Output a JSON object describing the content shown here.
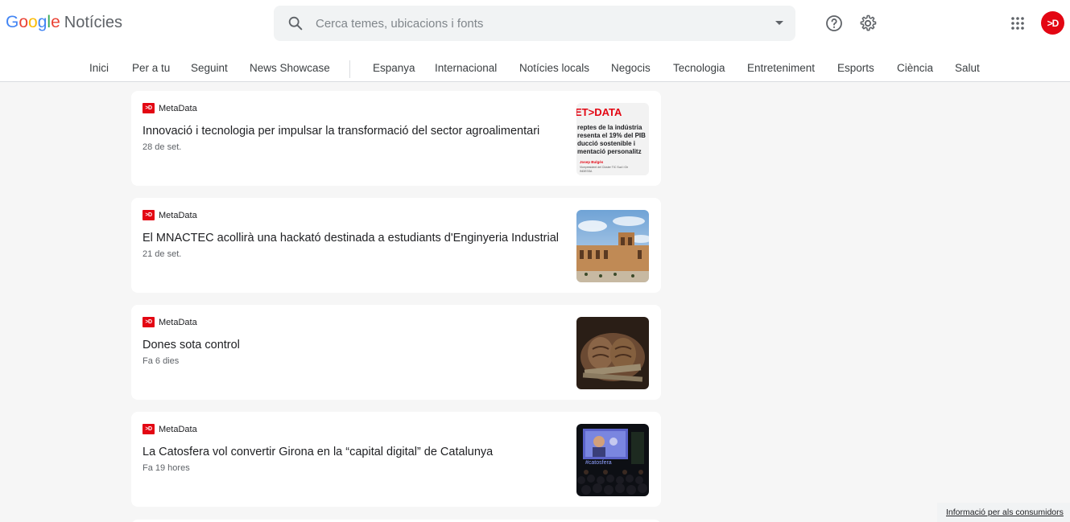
{
  "app": {
    "logo_letters": [
      "G",
      "o",
      "o",
      "g",
      "l",
      "e"
    ],
    "product": "Notícies"
  },
  "search": {
    "placeholder": "Cerca temes, ubicacions i fonts"
  },
  "header_icons": {
    "help": "help-icon",
    "settings": "gear-icon",
    "apps": "apps-grid-icon",
    "avatar_text": ">D"
  },
  "nav": {
    "items": [
      "Inici",
      "Per a tu",
      "Seguint",
      "News Showcase",
      "Espanya",
      "Internacional",
      "Notícies locals",
      "Negocis",
      "Tecnologia",
      "Entreteniment",
      "Esports",
      "Ciència",
      "Salut"
    ]
  },
  "articles": [
    {
      "source": "MetaData",
      "source_logo": ">D",
      "title": "Innovació i tecnologia per impulsar la transformació del sector agroalimentari",
      "time": "28 de set.",
      "thumb": {
        "brand": "ET>DATA",
        "lines": [
          "reptes de la indústria",
          "resenta el 19% del PIB",
          "ducció sostenible i",
          "mentació personalitz"
        ],
        "name": "Josep Bulgés",
        "role": "Vicepresident del Clúster TIC Sud i Gir",
        "org": "INDESSA"
      }
    },
    {
      "source": "MetaData",
      "source_logo": ">D",
      "title": "El MNACTEC acollirà una hackató destinada a estudiants d'Enginyeria Industrial",
      "time": "21 de set."
    },
    {
      "source": "MetaData",
      "source_logo": ">D",
      "title": "Dones sota control",
      "time": "Fa 6 dies"
    },
    {
      "source": "MetaData",
      "source_logo": ">D",
      "title": "La Catosfera vol convertir Girona en la “capital digital” de Catalunya",
      "time": "Fa 19 hores",
      "thumb": {
        "screen_text": "#catosfera"
      }
    }
  ],
  "footer": {
    "consumer_info": "Informació per als consumidors"
  }
}
